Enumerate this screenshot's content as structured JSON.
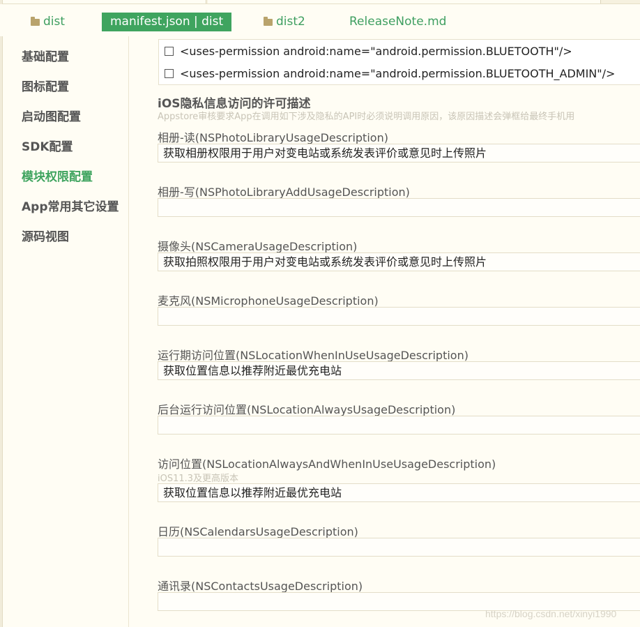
{
  "tabs": [
    {
      "label": "dist",
      "type": "folder"
    },
    {
      "label": "manifest.json | dist",
      "type": "file",
      "active": true
    },
    {
      "label": "dist2",
      "type": "folder"
    },
    {
      "label": "ReleaseNote.md",
      "type": "file"
    }
  ],
  "sidebar": {
    "items": [
      {
        "label": "基础配置"
      },
      {
        "label": "图标配置"
      },
      {
        "label": "启动图配置"
      },
      {
        "label": "SDK配置"
      },
      {
        "label": "模块权限配置",
        "active": true
      },
      {
        "label": "App常用其它设置"
      },
      {
        "label": "源码视图"
      }
    ]
  },
  "permissions": [
    {
      "label": "<uses-permission android:name=\"android.permission.BLUETOOTH\"/>",
      "checked": false
    },
    {
      "label": "<uses-permission android:name=\"android.permission.BLUETOOTH_ADMIN\"/>",
      "checked": false
    }
  ],
  "ios_section": {
    "title": "iOS隐私信息访问的许可描述",
    "description": "Appstore审核要求App在调用如下涉及隐私的API时必须说明调用原因，该原因描述会弹框给最终手机用"
  },
  "fields": [
    {
      "label": "相册-读(NSPhotoLibraryUsageDescription)",
      "value": "获取相册权限用于用户对变电站或系统发表评价或意见时上传照片"
    },
    {
      "label": "相册-写(NSPhotoLibraryAddUsageDescription)",
      "value": ""
    },
    {
      "label": "摄像头(NSCameraUsageDescription)",
      "value": "获取拍照权限用于用户对变电站或系统发表评价或意见时上传照片"
    },
    {
      "label": "麦克风(NSMicrophoneUsageDescription)",
      "value": ""
    },
    {
      "label": "运行期访问位置(NSLocationWhenInUseUsageDescription)",
      "value": "获取位置信息以推荐附近最优充电站"
    },
    {
      "label": "后台运行访问位置(NSLocationAlwaysUsageDescription)",
      "value": ""
    },
    {
      "label": "访问位置(NSLocationAlwaysAndWhenInUseUsageDescription)",
      "hint": "iOS11.3及更高版本",
      "value": "获取位置信息以推荐附近最优充电站"
    },
    {
      "label": "日历(NSCalendarsUsageDescription)",
      "value": ""
    },
    {
      "label": "通讯录(NSContactsUsageDescription)",
      "value": ""
    }
  ],
  "watermark": "https://blog.csdn.net/xinyi1990"
}
